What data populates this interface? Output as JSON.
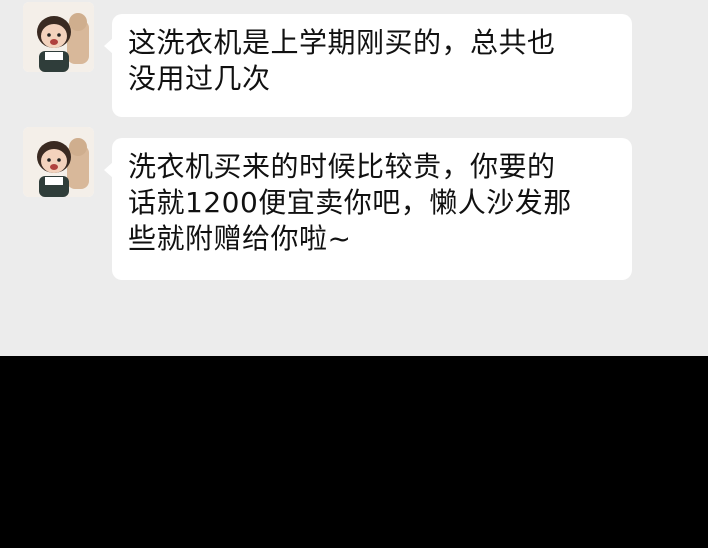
{
  "chat": {
    "messages": [
      {
        "sender": "avatar-girl",
        "lines": [
          "这洗衣机是上学期刚买的，总共也",
          "没用过几次"
        ]
      },
      {
        "sender": "avatar-girl",
        "lines": [
          "洗衣机买来的时候比较贵，你要的",
          "话就1200便宜卖你吧，懒人沙发那",
          "些就附赠给你啦~"
        ]
      }
    ]
  },
  "colors": {
    "chat_background": "#ececec",
    "bubble_background": "#ffffff",
    "text": "#111111",
    "overlay": "#000000"
  }
}
